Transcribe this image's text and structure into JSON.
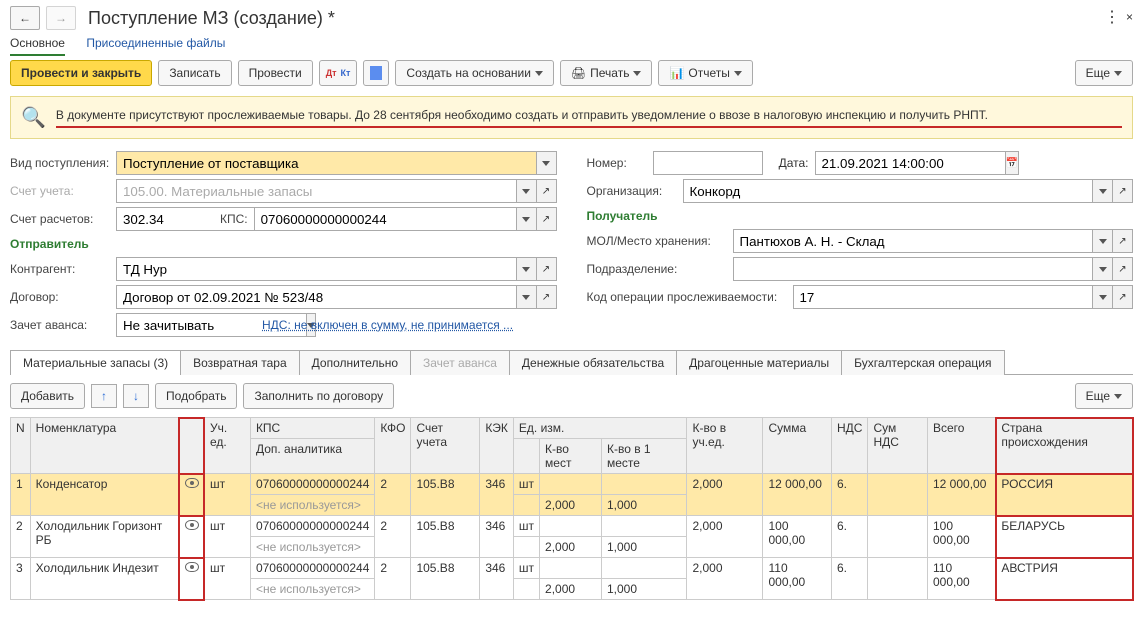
{
  "header": {
    "title": "Поступление МЗ (создание) *"
  },
  "topTabs": {
    "main": "Основное",
    "files": "Присоединенные файлы"
  },
  "buttons": {
    "postClose": "Провести и закрыть",
    "save": "Записать",
    "post": "Провести",
    "createFrom": "Создать на основании",
    "print": "Печать",
    "reports": "Отчеты",
    "more": "Еще"
  },
  "notice": "В документе присутствуют прослеживаемые товары. До 28 сентября необходимо создать и отправить уведомление о ввозе в налоговую инспекцию и получить РНПТ.",
  "labels": {
    "receiptType": "Вид поступления:",
    "account": "Счет учета:",
    "settleAccount": "Счет расчетов:",
    "kps": "КПС:",
    "sender": "Отправитель",
    "counterparty": "Контрагент:",
    "contract": "Договор:",
    "advance": "Зачет аванса:",
    "vatLink": "НДС: не включен в сумму, не принимается ...",
    "number": "Номер:",
    "date": "Дата:",
    "organization": "Организация:",
    "receiver": "Получатель",
    "mol": "МОЛ/Место хранения:",
    "subdivision": "Подразделение:",
    "traceCode": "Код операции прослеживаемости:"
  },
  "fields": {
    "receiptType": "Поступление от поставщика",
    "account": "105.00. Материальные запасы",
    "settleAccount": "302.34",
    "kps": "07060000000000244",
    "counterparty": "ТД Нур",
    "contract": "Договор от 02.09.2021 № 523/48",
    "advance": "Не зачитывать",
    "number": "",
    "date": "21.09.2021 14:00:00",
    "organization": "Конкорд",
    "mol": "Пантюхов А. Н. - Склад",
    "subdivision": "",
    "traceCode": "17"
  },
  "tabs2": {
    "materials": "Материальные запасы (3)",
    "tare": "Возвратная тара",
    "additional": "Дополнительно",
    "advance": "Зачет аванса",
    "obligations": "Денежные обязательства",
    "precious": "Драгоценные материалы",
    "accounting": "Бухгалтерская операция"
  },
  "subButtons": {
    "add": "Добавить",
    "pick": "Подобрать",
    "fillContract": "Заполнить по договору"
  },
  "gridHeaders": {
    "n": "N",
    "nomen": "Номенклатура",
    "unit": "Уч. ед.",
    "kps": "КПС",
    "kfo": "КФО",
    "account": "Счет учета",
    "kek": "КЭК",
    "measure": "Ед. изм.",
    "qtyUnit": "К-во в уч.ед.",
    "sum": "Сумма",
    "vat": "НДС",
    "vatSum": "Сум НДС",
    "total": "Всего",
    "country": "Страна происхождения",
    "dopAnal": "Доп. аналитика",
    "qtyPlaces": "К-во мест",
    "qtyInPlace": "К-во в 1 месте"
  },
  "rows": [
    {
      "n": "1",
      "nomen": "Конденсатор",
      "unit": "шт",
      "kps": "07060000000000244",
      "kfo": "2",
      "account": "105.В8",
      "kek": "346",
      "measure": "шт",
      "qtyUnit": "2,000",
      "sum": "12 000,00",
      "vat": "6.",
      "vatSum": "",
      "total": "12 000,00",
      "country": "РОССИЯ",
      "dopAnal": "<не используется>",
      "qtyPlaces": "2,000",
      "qtyInPlace": "1,000"
    },
    {
      "n": "2",
      "nomen": "Холодильник Горизонт РБ",
      "unit": "шт",
      "kps": "07060000000000244",
      "kfo": "2",
      "account": "105.В8",
      "kek": "346",
      "measure": "шт",
      "qtyUnit": "2,000",
      "sum": "100 000,00",
      "vat": "6.",
      "vatSum": "",
      "total": "100 000,00",
      "country": "БЕЛАРУСЬ",
      "dopAnal": "<не используется>",
      "qtyPlaces": "2,000",
      "qtyInPlace": "1,000"
    },
    {
      "n": "3",
      "nomen": "Холодильник Индезит",
      "unit": "шт",
      "kps": "07060000000000244",
      "kfo": "2",
      "account": "105.В8",
      "kek": "346",
      "measure": "шт",
      "qtyUnit": "2,000",
      "sum": "110 000,00",
      "vat": "6.",
      "vatSum": "",
      "total": "110 000,00",
      "country": "АВСТРИЯ",
      "dopAnal": "<не используется>",
      "qtyPlaces": "2,000",
      "qtyInPlace": "1,000"
    }
  ]
}
